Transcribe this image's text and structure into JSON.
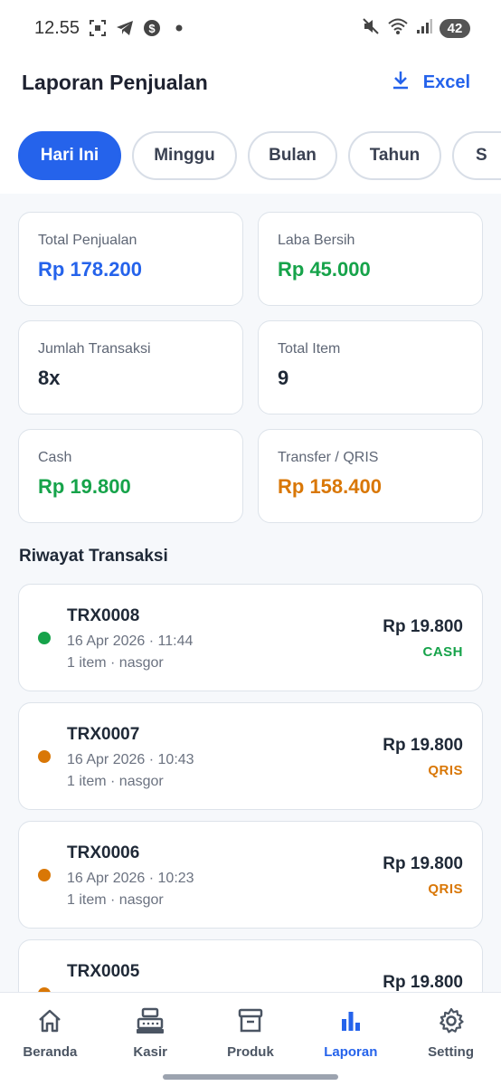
{
  "status_bar": {
    "time": "12.55",
    "battery": "42"
  },
  "header": {
    "title": "Laporan Penjualan",
    "export_label": "Excel"
  },
  "tabs": [
    {
      "label": "Hari Ini",
      "active": true
    },
    {
      "label": "Minggu",
      "active": false
    },
    {
      "label": "Bulan",
      "active": false
    },
    {
      "label": "Tahun",
      "active": false
    },
    {
      "label": "S",
      "active": false
    }
  ],
  "summary": [
    {
      "label": "Total Penjualan",
      "value": "Rp 178.200",
      "color": "#2563eb"
    },
    {
      "label": "Laba Bersih",
      "value": "Rp 45.000",
      "color": "#16a34a"
    },
    {
      "label": "Jumlah Transaksi",
      "value": "8x",
      "color": "#1f2937"
    },
    {
      "label": "Total Item",
      "value": "9",
      "color": "#1f2937"
    },
    {
      "label": "Cash",
      "value": "Rp 19.800",
      "color": "#16a34a"
    },
    {
      "label": "Transfer / QRIS",
      "value": "Rp 158.400",
      "color": "#d97706"
    }
  ],
  "history_title": "Riwayat Transaksi",
  "transactions": [
    {
      "id": "TRX0008",
      "datetime": "16 Apr 2026 · 11:44",
      "items": "1 item · nasgor",
      "amount": "Rp 19.800",
      "method": "CASH",
      "color": "#16a34a"
    },
    {
      "id": "TRX0007",
      "datetime": "16 Apr 2026 · 10:43",
      "items": "1 item · nasgor",
      "amount": "Rp 19.800",
      "method": "QRIS",
      "color": "#d97706"
    },
    {
      "id": "TRX0006",
      "datetime": "16 Apr 2026 · 10:23",
      "items": "1 item · nasgor",
      "amount": "Rp 19.800",
      "method": "QRIS",
      "color": "#d97706"
    },
    {
      "id": "TRX0005",
      "datetime": "",
      "items": "",
      "amount": "Rp 19.800",
      "method": "",
      "color": "#d97706"
    }
  ],
  "nav": [
    {
      "label": "Beranda",
      "icon": "home-icon",
      "active": false
    },
    {
      "label": "Kasir",
      "icon": "cash-register-icon",
      "active": false
    },
    {
      "label": "Produk",
      "icon": "archive-box-icon",
      "active": false
    },
    {
      "label": "Laporan",
      "icon": "bar-chart-icon",
      "active": true
    },
    {
      "label": "Setting",
      "icon": "gear-icon",
      "active": false
    }
  ],
  "colors": {
    "accent": "#2563eb",
    "success": "#16a34a",
    "warning": "#d97706"
  }
}
